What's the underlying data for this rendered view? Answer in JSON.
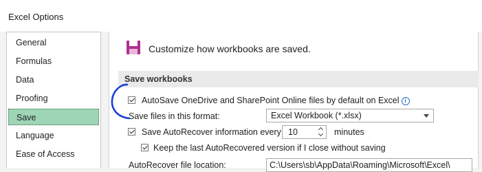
{
  "window": {
    "title": "Excel Options"
  },
  "sidebar": {
    "items": [
      {
        "label": "General"
      },
      {
        "label": "Formulas"
      },
      {
        "label": "Data"
      },
      {
        "label": "Proofing"
      },
      {
        "label": "Save",
        "selected": true
      },
      {
        "label": "Language"
      },
      {
        "label": "Ease of Access"
      }
    ]
  },
  "main": {
    "heading": "Customize how workbooks are saved.",
    "heading_icon": "save-icon",
    "section_title": "Save workbooks",
    "autosave": {
      "label": "AutoSave OneDrive and SharePoint Online files by default on Excel",
      "checked": true
    },
    "format": {
      "label": "Save files in this format:",
      "value": "Excel Workbook (*.xlsx)"
    },
    "autorecover": {
      "label": "Save AutoRecover information every",
      "value": "10",
      "unit": "minutes",
      "checked": true
    },
    "keep_last": {
      "label": "Keep the last AutoRecovered version if I close without saving",
      "checked": true
    },
    "location": {
      "label": "AutoRecover file location:",
      "value": "C:\\Users\\sb\\AppData\\Roaming\\Microsoft\\Excel\\"
    }
  },
  "colors": {
    "selected_nav": "#9fd5b7",
    "save_icon": "#b0308f",
    "annotation": "#1a3fd6"
  }
}
